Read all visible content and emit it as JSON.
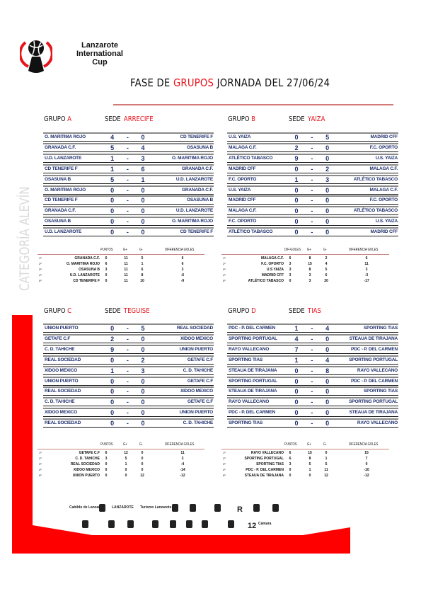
{
  "brand": {
    "line1": "Lanzarote",
    "line2": "International",
    "line3": "Cup"
  },
  "header": {
    "prefix": "FASE DE",
    "highlight": "GRUPOS",
    "suffix": "JORNADA DEL 27/06/24"
  },
  "category": "CATEGORÍA ALEVÍN",
  "colors": {
    "accent": "#e8141c",
    "team_text": "#1f2f6e",
    "rule": "#d27a7a"
  },
  "groups": [
    {
      "label": "GRUPO",
      "letter": "A",
      "sede_label": "SEDE",
      "sede": "ARRECIFE",
      "matches": [
        {
          "home": "O. MARITIMA ROJO",
          "hs": "4",
          "sep": "-",
          "as": "0",
          "away": "CD TENERIFE F"
        },
        {
          "home": "GRANADA C.F.",
          "hs": "5",
          "sep": "-",
          "as": "4",
          "away": "OSASUNA B"
        },
        {
          "home": "U.D. LANZAROTE",
          "hs": "1",
          "sep": "-",
          "as": "3",
          "away": "O. MARITIMA ROJO"
        },
        {
          "home": "CD TENERIFE F",
          "hs": "1",
          "sep": "-",
          "as": "6",
          "away": "GRANADA C.F."
        },
        {
          "home": "OSASUNA B",
          "hs": "5",
          "sep": "-",
          "as": "1",
          "away": "U.D. LANZAROTE"
        },
        {
          "home": "O. MARITIMA ROJO",
          "hs": "0",
          "sep": "-",
          "as": "0",
          "away": "GRANADA C.F."
        },
        {
          "home": "CD TENERIFE F",
          "hs": "0",
          "sep": "-",
          "as": "0",
          "away": "OSASUNA B"
        },
        {
          "home": "GRANADA C.F.",
          "hs": "0",
          "sep": "-",
          "as": "0",
          "away": "U.D. LANZAROTE"
        },
        {
          "home": "OSASUNA B",
          "hs": "0",
          "sep": "-",
          "as": "0",
          "away": "O. MARITIMA ROJO"
        },
        {
          "home": "U.D. LANZAROTE",
          "hs": "0",
          "sep": "-",
          "as": "0",
          "away": "CD TENERIFE F"
        }
      ],
      "standings": {
        "headers": [
          "PUNTOS",
          "G+",
          "G-",
          "DIFERENCIA GOLES"
        ],
        "rows": [
          {
            "pos": "1º",
            "team": "GRANADA C.F.",
            "a": "6",
            "b": "11",
            "c": "5",
            "d": "6"
          },
          {
            "pos": "2º",
            "team": "O. MARITIMA ROJO",
            "a": "6",
            "b": "11",
            "c": "1",
            "d": "6"
          },
          {
            "pos": "3º",
            "team": "OSASUNA B",
            "a": "3",
            "b": "11",
            "c": "6",
            "d": "3"
          },
          {
            "pos": "4º",
            "team": "U.D. LANZAROTE",
            "a": "0",
            "b": "11",
            "c": "8",
            "d": "-6"
          },
          {
            "pos": "5º",
            "team": "CD TENERIFE F",
            "a": "0",
            "b": "11",
            "c": "10",
            "d": "-9"
          }
        ]
      }
    },
    {
      "label": "GRUPO",
      "letter": "B",
      "sede_label": "SEDE",
      "sede": "YAIZA",
      "matches": [
        {
          "home": "U.S. YAIZA",
          "hs": "0",
          "sep": "-",
          "as": "5",
          "away": "MADRID CFF"
        },
        {
          "home": "MALAGA C.F.",
          "hs": "2",
          "sep": "-",
          "as": "0",
          "away": "F.C. OPORTO"
        },
        {
          "home": "ATLÉTICO TABASCO",
          "hs": "9",
          "sep": "-",
          "as": "0",
          "away": "U.S. YAIZA"
        },
        {
          "home": "MADRID CFF",
          "hs": "0",
          "sep": "-",
          "as": "2",
          "away": "MALAGA C.F."
        },
        {
          "home": "F.C. OPORTO",
          "hs": "1",
          "sep": "-",
          "as": "3",
          "away": "ATLÉTICO TABASCO"
        },
        {
          "home": "U.S. YAIZA",
          "hs": "0",
          "sep": "-",
          "as": "0",
          "away": "MALAGA C.F."
        },
        {
          "home": "MADRID CFF",
          "hs": "0",
          "sep": "-",
          "as": "0",
          "away": "F.C. OPORTO"
        },
        {
          "home": "MALAGA C.F.",
          "hs": "0",
          "sep": "-",
          "as": "0",
          "away": "ATLÉTICO TABASCO"
        },
        {
          "home": "F.C. OPORTO",
          "hs": "0",
          "sep": "-",
          "as": "0",
          "away": "U.S. YAIZA"
        },
        {
          "home": "ATLÉTICO TABASCO",
          "hs": "0",
          "sep": "-",
          "as": "0",
          "away": "MADRID CFF"
        }
      ],
      "standings": {
        "headers": [
          "DIF-GOLES",
          "G+",
          "G-",
          "DIFERENCIA GOLES"
        ],
        "rows": [
          {
            "pos": "1º",
            "team": "MALAGA C.F.",
            "a": "6",
            "b": "8",
            "c": "2",
            "d": "6"
          },
          {
            "pos": "2º",
            "team": "F.C. OPORTO",
            "a": "3",
            "b": "15",
            "c": "4",
            "d": "11"
          },
          {
            "pos": "3º",
            "team": "U.S YAIZA",
            "a": "3",
            "b": "8",
            "c": "5",
            "d": "3"
          },
          {
            "pos": "4º",
            "team": "MADRID CFF",
            "a": "3",
            "b": "3",
            "c": "6",
            "d": "-3"
          },
          {
            "pos": "5º",
            "team": "ATLÉTICO TABASCO",
            "a": "0",
            "b": "3",
            "c": "20",
            "d": "-17"
          }
        ]
      }
    },
    {
      "label": "GRUPO",
      "letter": "C",
      "sede_label": "SEDE",
      "sede": "TEGUISE",
      "matches": [
        {
          "home": "UNION PUERTO",
          "hs": "0",
          "sep": "-",
          "as": "5",
          "away": "REAL SOCIEDAD"
        },
        {
          "home": "GETAFE C.F",
          "hs": "2",
          "sep": "-",
          "as": "0",
          "away": "XIDOO MEXICO"
        },
        {
          "home": "C. D. TAHICHE",
          "hs": "9",
          "sep": "-",
          "as": "0",
          "away": "UNION PUERTO"
        },
        {
          "home": "REAL SOCIEDAD",
          "hs": "0",
          "sep": "-",
          "as": "2",
          "away": "GETAFE C.F"
        },
        {
          "home": "XIDOO MEXICO",
          "hs": "1",
          "sep": "-",
          "as": "3",
          "away": "C. D. TAHICHE"
        },
        {
          "home": "UNION PUERTO",
          "hs": "0",
          "sep": "-",
          "as": "0",
          "away": "GETAFE C.F"
        },
        {
          "home": "REAL SOCIEDAD",
          "hs": "0",
          "sep": "-",
          "as": "0",
          "away": "XIDOO MEXICO"
        },
        {
          "home": "C. D. TAHICHE",
          "hs": "0",
          "sep": "-",
          "as": "0",
          "away": "GETAFE C.F"
        },
        {
          "home": "XIDOO MEXICO",
          "hs": "0",
          "sep": "-",
          "as": "0",
          "away": "UNION PUERTO"
        },
        {
          "home": "REAL SOCIEDAD",
          "hs": "0",
          "sep": "-",
          "as": "0",
          "away": "C. D. TAHICHE"
        }
      ],
      "standings": {
        "headers": [
          "PUNTOS",
          "G+",
          "G-",
          "DIFERENCIA GOLES"
        ],
        "rows": [
          {
            "pos": "1º",
            "team": "GETAFE C.F",
            "a": "6",
            "b": "12",
            "c": "0",
            "d": "11"
          },
          {
            "pos": "2º",
            "team": "C. D. TAHICHE",
            "a": "3",
            "b": "5",
            "c": "0",
            "d": "3"
          },
          {
            "pos": "3º",
            "team": "REAL SOCIEDAD",
            "a": "0",
            "b": "1",
            "c": "0",
            "d": "-4"
          },
          {
            "pos": "4º",
            "team": "XIDOO MEXICO",
            "a": "0",
            "b": "0",
            "c": "0",
            "d": "-14"
          },
          {
            "pos": "5º",
            "team": "UNION PUERTO",
            "a": "0",
            "b": "0",
            "c": "12",
            "d": "-12"
          }
        ]
      }
    },
    {
      "label": "GRUPO",
      "letter": "D",
      "sede_label": "SEDE",
      "sede": "TIAS",
      "matches": [
        {
          "home": "PDC - P. DEL CARMEN",
          "hs": "1",
          "sep": "-",
          "as": "4",
          "away": "SPORTING TIAS"
        },
        {
          "home": "SPORTING PORTUGAL",
          "hs": "4",
          "sep": "-",
          "as": "0",
          "away": "STEAUA DE TIRAJANA"
        },
        {
          "home": "RAYO VALLECANO",
          "hs": "7",
          "sep": "-",
          "as": "0",
          "away": "PDC - P. DEL CARMEN"
        },
        {
          "home": "SPORTING TIAS",
          "hs": "1",
          "sep": "-",
          "as": "4",
          "away": "SPORTING PORTUGAL"
        },
        {
          "home": "STEAUA DE TIRAJANA",
          "hs": "0",
          "sep": "-",
          "as": "8",
          "away": "RAYO VALLECANO"
        },
        {
          "home": "SPORTING PORTUGAL",
          "hs": "0",
          "sep": "-",
          "as": "0",
          "away": "PDC - P. DEL CARMEN"
        },
        {
          "home": "STEAUA DE TIRAJANA",
          "hs": "0",
          "sep": "-",
          "as": "0",
          "away": "SPORTING TIAS"
        },
        {
          "home": "RAYO VALLECANO",
          "hs": "0",
          "sep": "-",
          "as": "0",
          "away": "SPORTING PORTUGAL"
        },
        {
          "home": "PDC - P. DEL CARMEN",
          "hs": "0",
          "sep": "-",
          "as": "0",
          "away": "STEAUA DE TIRAJANA"
        },
        {
          "home": "SPORTING TIAS",
          "hs": "0",
          "sep": "-",
          "as": "0",
          "away": "RAYO VALLECANO"
        }
      ],
      "standings": {
        "headers": [
          "PUNTOS",
          "G+",
          "G-",
          "DIFERENCIA GOLES"
        ],
        "rows": [
          {
            "pos": "1º",
            "team": "RAYO VALLECANO",
            "a": "6",
            "b": "15",
            "c": "0",
            "d": "15"
          },
          {
            "pos": "2º",
            "team": "SPORTING PORTUGAL",
            "a": "6",
            "b": "8",
            "c": "1",
            "d": "7"
          },
          {
            "pos": "3º",
            "team": "SPORTING TIAS",
            "a": "3",
            "b": "5",
            "c": "5",
            "d": "0"
          },
          {
            "pos": "4º",
            "team": "PDC - P. DEL CARMEN",
            "a": "0",
            "b": "1",
            "c": "11",
            "d": "-10"
          },
          {
            "pos": "5º",
            "team": "STEAUA DE TIRAJANA",
            "a": "0",
            "b": "0",
            "c": "12",
            "d": "-12"
          }
        ]
      }
    }
  ],
  "sponsors": {
    "row1": [
      "Cabildo de Lanzarote",
      "",
      "LANZAROTE",
      "Turismo Lanzarote",
      "",
      "",
      "",
      "R",
      "",
      ""
    ],
    "row2": [
      "",
      "",
      "",
      "",
      "",
      "",
      "",
      "",
      "12",
      "Cámara"
    ]
  }
}
